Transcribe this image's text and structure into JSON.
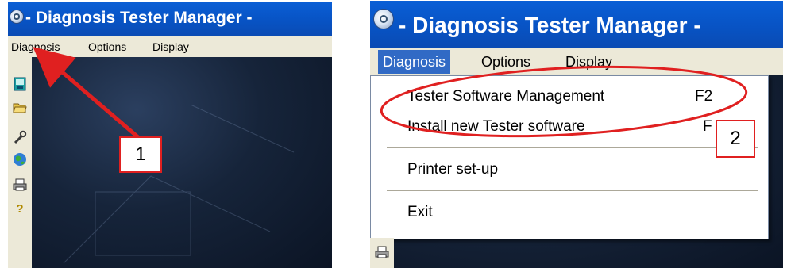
{
  "left_panel": {
    "title": "- Diagnosis Tester Manager  -",
    "menu": [
      "Diagnosis",
      "Options",
      "Display"
    ],
    "toolbar_icons": [
      "tester-icon",
      "open-folder-icon",
      "wrench-icon",
      "globe-icon",
      "printer-icon",
      "help-icon"
    ],
    "callout_label": "1"
  },
  "right_panel": {
    "title": "- Diagnosis Tester Manager  -",
    "menu": [
      "Diagnosis",
      "Options",
      "Display"
    ],
    "dropdown": [
      {
        "label": "Tester Software Management",
        "shortcut": "F2"
      },
      {
        "label": "Install new Tester software",
        "shortcut": "F"
      },
      {
        "label": "Printer set-up",
        "shortcut": ""
      },
      {
        "label": "Exit",
        "shortcut": ""
      }
    ],
    "toolbar_icons": [
      "printer-icon"
    ],
    "callout_label": "2"
  },
  "colors": {
    "titlebar": "#0853c4",
    "menubar": "#ece9d8",
    "highlight": "#316ac5",
    "annotation": "#e02020"
  }
}
